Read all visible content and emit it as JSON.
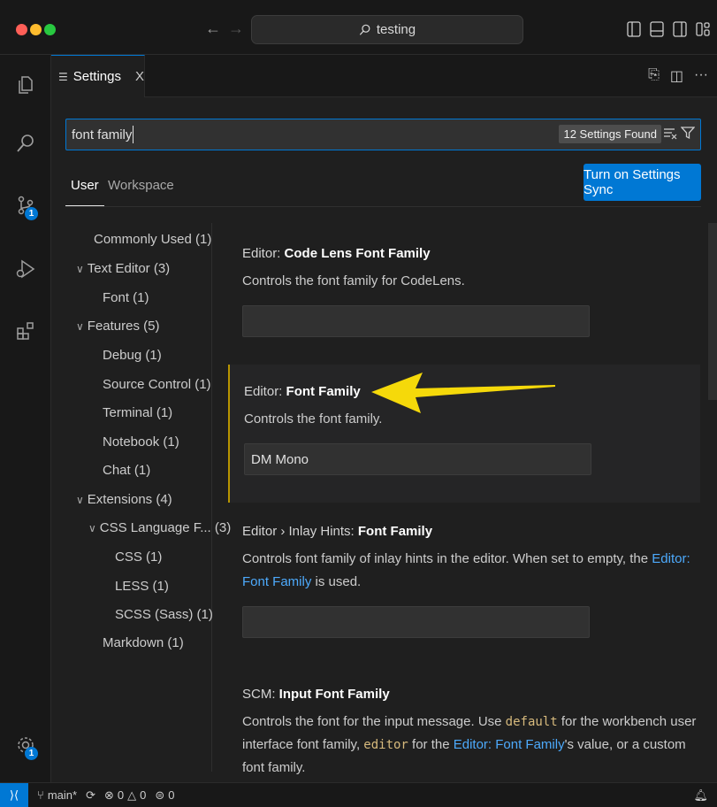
{
  "titlebar": {
    "search_text": "testing",
    "nav_back": "←",
    "nav_forward": "→"
  },
  "tab": {
    "label": "Settings",
    "close": "X"
  },
  "search": {
    "query": "font family",
    "results_badge": "12 Settings Found"
  },
  "scope_tabs": {
    "user": "User",
    "workspace": "Workspace"
  },
  "sync_button": "Turn on Settings Sync",
  "toc": [
    {
      "label": "Commonly Used (1)",
      "chevron": ""
    },
    {
      "label": "Text Editor (3)",
      "chevron": "∨"
    },
    {
      "label": "Font (1)",
      "chevron": ""
    },
    {
      "label": "Features (5)",
      "chevron": "∨"
    },
    {
      "label": "Debug (1)",
      "chevron": ""
    },
    {
      "label": "Source Control (1)",
      "chevron": ""
    },
    {
      "label": "Terminal (1)",
      "chevron": ""
    },
    {
      "label": "Notebook (1)",
      "chevron": ""
    },
    {
      "label": "Chat (1)",
      "chevron": ""
    },
    {
      "label": "Extensions (4)",
      "chevron": "∨"
    },
    {
      "label": "CSS Language F... (3)",
      "chevron": "∨"
    },
    {
      "label": "CSS (1)",
      "chevron": ""
    },
    {
      "label": "LESS (1)",
      "chevron": ""
    },
    {
      "label": "SCSS (Sass) (1)",
      "chevron": ""
    },
    {
      "label": "Markdown (1)",
      "chevron": ""
    }
  ],
  "settings": {
    "s1": {
      "category": "Editor: ",
      "name": "Code Lens Font Family",
      "description": "Controls the font family for CodeLens.",
      "value": ""
    },
    "s2": {
      "category": "Editor: ",
      "name": "Font Family",
      "description": "Controls the font family.",
      "value": "DM Mono"
    },
    "s3": {
      "category": "Editor › Inlay Hints: ",
      "name": "Font Family",
      "desc_part1": "Controls font family of inlay hints in the editor. When set to empty, the ",
      "desc_link": "Editor: Font Family",
      "desc_part2": " is used.",
      "value": ""
    },
    "s4": {
      "category": "SCM: ",
      "name": "Input Font Family",
      "desc_part1": "Controls the font for the input message. Use ",
      "desc_code1": "default",
      "desc_part2": " for the workbench user interface font family, ",
      "desc_code2": "editor",
      "desc_part3": " for the ",
      "desc_link": "Editor: Font Family",
      "desc_part4": "'s value, or a custom font family."
    }
  },
  "activity_badges": {
    "source_control": "1",
    "manage": "1"
  },
  "statusbar": {
    "branch": "main*",
    "errors": "0",
    "warnings": "0",
    "ports": "0"
  },
  "colors": {
    "accent": "#0078d4",
    "link": "#4daafc",
    "annotation_arrow": "#f5d90a"
  },
  "icons": [
    "explorer-icon",
    "search-icon",
    "source-control-icon",
    "run-debug-icon",
    "extensions-icon",
    "manage-gear-icon",
    "bell-icon",
    "branch-icon",
    "sync-icon",
    "filter-icon",
    "clear-filter-icon"
  ]
}
